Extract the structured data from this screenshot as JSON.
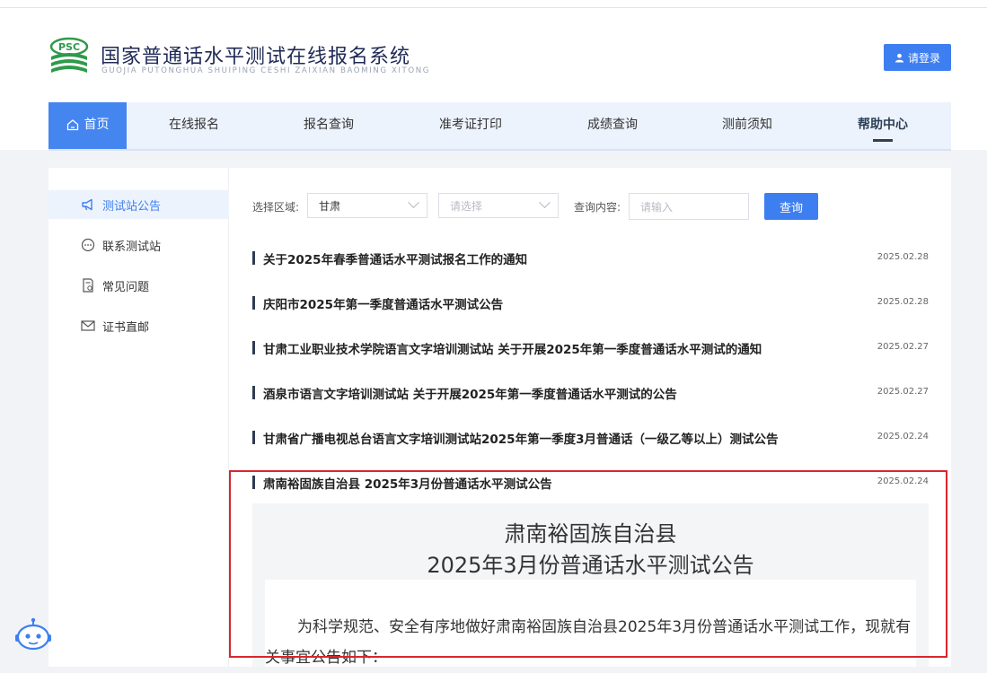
{
  "site": {
    "logo_text": "PSC",
    "title": "国家普通话水平测试在线报名系统",
    "subtitle": "GUOJIA PUTONGHUA SHUIPING CESHI ZAIXIAN BAOMING XITONG",
    "login_label": "请登录"
  },
  "nav": {
    "items": [
      {
        "label": "首页"
      },
      {
        "label": "在线报名"
      },
      {
        "label": "报名查询"
      },
      {
        "label": "准考证打印"
      },
      {
        "label": "成绩查询"
      },
      {
        "label": "测前须知"
      },
      {
        "label": "帮助中心"
      }
    ]
  },
  "sidebar": {
    "items": [
      {
        "label": "测试站公告",
        "icon": "megaphone-icon"
      },
      {
        "label": "联系测试站",
        "icon": "chat-icon"
      },
      {
        "label": "常见问题",
        "icon": "document-question-icon"
      },
      {
        "label": "证书直邮",
        "icon": "mail-icon"
      }
    ]
  },
  "filters": {
    "region_label": "选择区域:",
    "region_value": "甘肃",
    "sub_region_placeholder": "请选择",
    "query_label": "查询内容:",
    "query_placeholder": "请输入",
    "query_button": "查询"
  },
  "notices": [
    {
      "title": "关于2025年春季普通话水平测试报名工作的通知",
      "date": "2025.02.28"
    },
    {
      "title": "庆阳市2025年第一季度普通话水平测试公告",
      "date": "2025.02.28"
    },
    {
      "title": "甘肃工业职业技术学院语言文字培训测试站 关于开展2025年第一季度普通话水平测试的通知",
      "date": "2025.02.27"
    },
    {
      "title": "酒泉市语言文字培训测试站 关于开展2025年第一季度普通话水平测试的公告",
      "date": "2025.02.27"
    },
    {
      "title": "甘肃省广播电视总台语言文字培训测试站2025年第一季度3月普通话（一级乙等以上）测试公告",
      "date": "2025.02.24"
    },
    {
      "title": "肃南裕固族自治县 2025年3月份普通话水平测试公告",
      "date": "2025.02.24"
    }
  ],
  "preview": {
    "heading_line1": "肃南裕固族自治县",
    "heading_line2": "2025年3月份普通话水平测试公告",
    "body": "为科学规范、安全有序地做好肃南裕固族自治县2025年3月份普通话水平测试工作，现就有关事宜公告如下："
  },
  "colors": {
    "accent": "#3d7ff0",
    "nav_bg": "#edf3fd",
    "highlight_border": "#d9262c"
  }
}
